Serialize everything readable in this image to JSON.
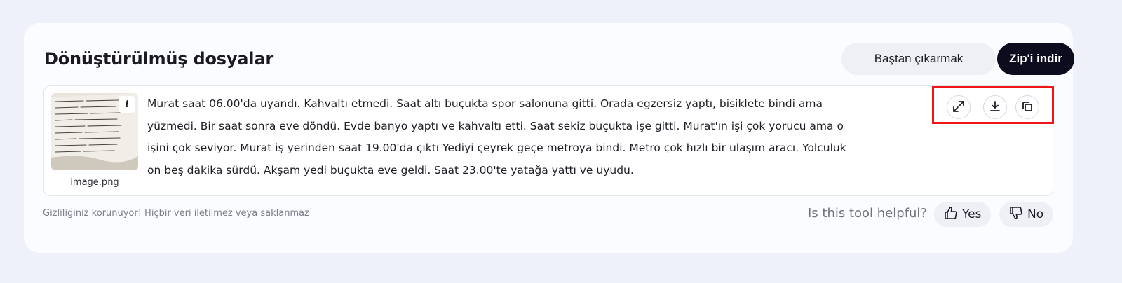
{
  "panel": {
    "title": "Dönüştürülmüş dosyalar",
    "reset_label": "Baştan çıkarmak",
    "zip_label": "Zip'i indir"
  },
  "result": {
    "filename": "image.png",
    "info_label": "i",
    "text": " Murat saat 06.00'da uyandı. Kahvaltı etmedi. Saat altı buçukta spor salonuna gitti. Orada egzersiz yaptı, bisiklete bindi ama yüzmedi. Bir saat sonra eve döndü. Evde banyo yaptı ve kahvaltı etti. Saat sekiz buçukta işe gitti. Murat'ın işi çok yorucu ama o işini çok seviyor. Murat iş yerinden saat 19.00'da çıktı Yediyi çeyrek geçe metroya bindi. Metro çok hızlı bir ulaşım aracı. Yolculuk on beş dakika sürdü. Akşam yedi buçukta eve geldi. Saat 23.00'te yatağa yattı ve uyudu.",
    "actions": [
      {
        "icon": "expand-icon"
      },
      {
        "icon": "download-icon"
      },
      {
        "icon": "copy-icon"
      }
    ]
  },
  "footer": {
    "privacy": "Gizliliğiniz korunuyor! Hiçbir veri iletilmez veya saklanmaz",
    "helpful_question": "Is this tool helpful?",
    "yes_label": "Yes",
    "no_label": "No"
  },
  "colors": {
    "background": "#eef1f9",
    "card": "#fbfcff",
    "primary_button": "#0d0b1e",
    "highlight": "#f01616"
  }
}
